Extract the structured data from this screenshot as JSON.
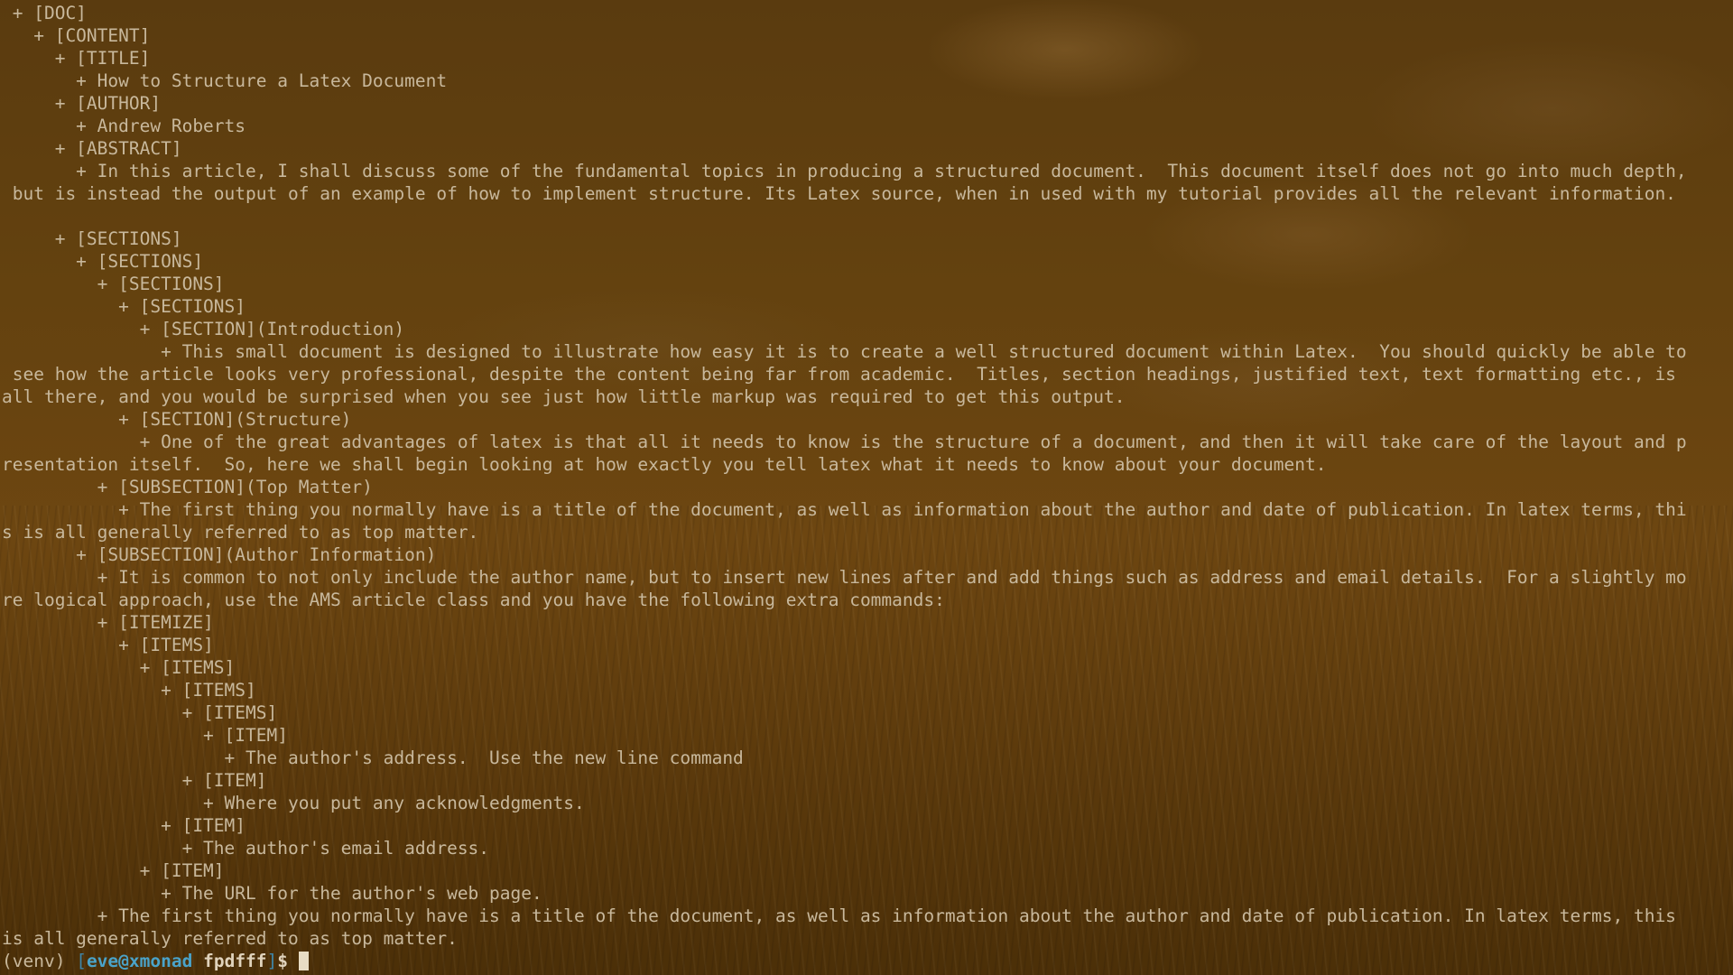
{
  "terminal": {
    "lines": [
      " + [DOC]",
      "   + [CONTENT]",
      "     + [TITLE]",
      "       + How to Structure a Latex Document",
      "     + [AUTHOR]",
      "       + Andrew Roberts",
      "     + [ABSTRACT]",
      "       + In this article, I shall discuss some of the fundamental topics in producing a structured document.  This document itself does not go into much depth,",
      " but is instead the output of an example of how to implement structure. Its Latex source, when in used with my tutorial provides all the relevant information.",
      "",
      "     + [SECTIONS]",
      "       + [SECTIONS]",
      "         + [SECTIONS]",
      "           + [SECTIONS]",
      "             + [SECTION](Introduction)",
      "               + This small document is designed to illustrate how easy it is to create a well structured document within Latex.  You should quickly be able to",
      " see how the article looks very professional, despite the content being far from academic.  Titles, section headings, justified text, text formatting etc., is",
      "all there, and you would be surprised when you see just how little markup was required to get this output.",
      "           + [SECTION](Structure)",
      "             + One of the great advantages of latex is that all it needs to know is the structure of a document, and then it will take care of the layout and p",
      "resentation itself.  So, here we shall begin looking at how exactly you tell latex what it needs to know about your document.",
      "         + [SUBSECTION](Top Matter)",
      "           + The first thing you normally have is a title of the document, as well as information about the author and date of publication. In latex terms, thi",
      "s is all generally referred to as top matter.",
      "       + [SUBSECTION](Author Information)",
      "         + It is common to not only include the author name, but to insert new lines after and add things such as address and email details.  For a slightly mo",
      "re logical approach, use the AMS article class and you have the following extra commands:",
      "         + [ITEMIZE]",
      "           + [ITEMS]",
      "             + [ITEMS]",
      "               + [ITEMS]",
      "                 + [ITEMS]",
      "                   + [ITEM]",
      "                     + The author's address.  Use the new line command",
      "                 + [ITEM]",
      "                   + Where you put any acknowledgments.",
      "               + [ITEM]",
      "                 + The author's email address.",
      "             + [ITEM]",
      "               + The URL for the author's web page.",
      "         + The first thing you normally have is a title of the document, as well as information about the author and date of publication. In latex terms, this",
      "is all generally referred to as top matter."
    ],
    "prompt": {
      "venv": "(venv) ",
      "open_bracket": "[",
      "user_host": "eve@xmonad",
      "space": " ",
      "dir": "fpdfff",
      "close_bracket": "]",
      "dollar": "$"
    }
  }
}
